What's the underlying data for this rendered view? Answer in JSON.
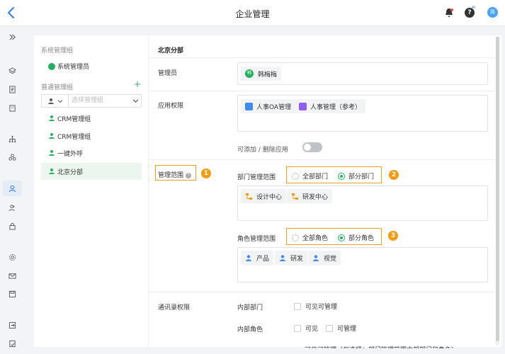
{
  "header": {
    "title": "企业管理",
    "ai_badge": "AI",
    "avatar_text": "简",
    "help_symbol": "?"
  },
  "rail": {
    "icons": [
      "collapse-icon",
      "layers-icon",
      "document-icon",
      "building-icon",
      "org-chart-icon",
      "group-icon",
      "user-icon",
      "users-icon",
      "lock-icon",
      "settings-icon",
      "mail-icon",
      "save-icon",
      "exit-icon",
      "log-icon"
    ]
  },
  "groups": {
    "system_title": "系统管理组",
    "system_admin": "系统管理员",
    "normal_title": "普通管理组",
    "add_symbol": "+",
    "filter_placeholder": "选择管理组",
    "items": [
      {
        "label": "CRM管理组"
      },
      {
        "label": "CRM管理组"
      },
      {
        "label": "一键外呼"
      },
      {
        "label": "北京分部"
      }
    ]
  },
  "detail": {
    "title": "北京分部",
    "admin_label": "管理员",
    "admin_avatar": "韩",
    "admin_name": "韩梅梅",
    "apps_label": "应用权限",
    "apps": [
      {
        "name": "人事OA管理",
        "color": "#3d8bef"
      },
      {
        "name": "人事管理（参考）",
        "color": "#8e5cf0"
      }
    ],
    "toggle_label": "可添加 / 删除应用",
    "scope_label": "管理范围",
    "dept_scope_label": "部门管理范围",
    "dept_options": [
      "全部部门",
      "部分部门"
    ],
    "depts": [
      "设计中心",
      "研发中心"
    ],
    "role_scope_label": "角色管理范围",
    "role_options": [
      "全部角色",
      "部分角色"
    ],
    "roles": [
      "产品",
      "研发",
      "视觉"
    ],
    "contacts_label": "通讯录权限",
    "internal_dept_label": "内部部门",
    "internal_dept_opt": "可见可管理",
    "internal_role_label": "内部角色",
    "internal_role_opts": [
      "可见",
      "可管理"
    ],
    "cut_text": "可见可管理（仅选择：部门管理范围内部部门和角色）"
  },
  "markers": [
    "1",
    "2",
    "3"
  ],
  "colors": {
    "accent": "#27ae60",
    "highlight": "#f0a020",
    "marker": "#f39c12"
  }
}
